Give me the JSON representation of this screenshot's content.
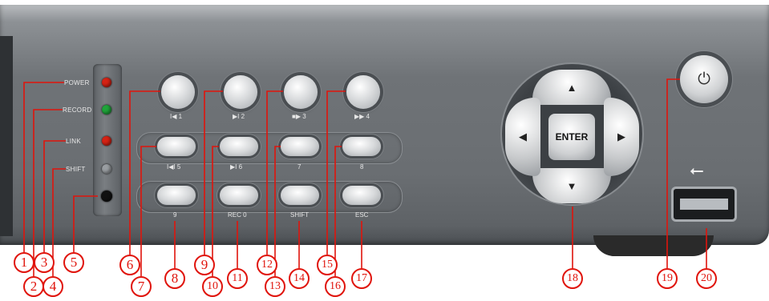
{
  "leds": [
    {
      "label": "POWER",
      "color": "#d62214"
    },
    {
      "label": "RECORD",
      "color": "#1fa43a"
    },
    {
      "label": "LINK",
      "color": "#d62214"
    },
    {
      "label": "SHIFT",
      "color": "#9a9ea2"
    },
    {
      "label": "",
      "color": "#111111"
    }
  ],
  "top_buttons": [
    {
      "label": "I◀ 1"
    },
    {
      "label": "▶I 2"
    },
    {
      "label": "■▶ 3"
    },
    {
      "label": "▶▶ 4"
    }
  ],
  "row2_buttons": [
    {
      "label": "I◀I 5"
    },
    {
      "label": "▶I 6"
    },
    {
      "label": "7"
    },
    {
      "label": "8"
    }
  ],
  "row3_buttons": [
    {
      "label": "9"
    },
    {
      "label": "REC 0"
    },
    {
      "label": "SHIFT"
    },
    {
      "label": "ESC"
    }
  ],
  "dpad": {
    "enter": "ENTER",
    "up": "▲",
    "down": "▼",
    "left": "◀",
    "right": "▶"
  },
  "power_symbol": "⏻",
  "usb_symbol": "⭠",
  "callouts": [
    "1",
    "2",
    "3",
    "4",
    "5",
    "6",
    "7",
    "8",
    "9",
    "10",
    "11",
    "12",
    "13",
    "14",
    "15",
    "16",
    "17",
    "18",
    "19",
    "20"
  ],
  "accent_color": "#e0140c"
}
